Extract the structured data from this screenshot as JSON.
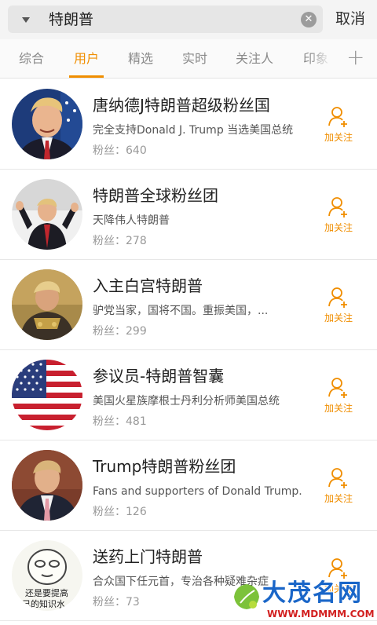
{
  "search": {
    "query": "特朗普",
    "clear_icon": "clear-icon",
    "cancel_label": "取消"
  },
  "tabs": [
    {
      "label": "综合",
      "active": false
    },
    {
      "label": "用户",
      "active": true
    },
    {
      "label": "精选",
      "active": false
    },
    {
      "label": "实时",
      "active": false
    },
    {
      "label": "关注人",
      "active": false
    },
    {
      "label": "印象",
      "active": false
    }
  ],
  "add_tab_icon": "plus-icon",
  "accent_color": "#f08e00",
  "users": [
    {
      "name": "唐纳德J特朗普超级粉丝国",
      "desc": "完全支持Donald J. Trump 当选美国总统",
      "fans_label": "粉丝：",
      "fans": "640",
      "follow_label": "加关注"
    },
    {
      "name": "特朗普全球粉丝团",
      "desc": "天降伟人特朗普",
      "fans_label": "粉丝：",
      "fans": "278",
      "follow_label": "加关注"
    },
    {
      "name": "入主白宫特朗普",
      "desc": "驴党当家，国将不国。重振美国，...",
      "fans_label": "粉丝：",
      "fans": "299",
      "follow_label": "加关注"
    },
    {
      "name": "参议员-特朗普智囊",
      "desc": "美国火星族摩根士丹利分析师美国总统",
      "fans_label": "粉丝：",
      "fans": "481",
      "follow_label": "加关注"
    },
    {
      "name": "Trump特朗普粉丝团",
      "desc": "Fans and supporters of Donald Trump.",
      "fans_label": "粉丝：",
      "fans": "126",
      "follow_label": "加关注"
    },
    {
      "name": "送药上门特朗普",
      "desc": "合众国下任元首，专治各种疑难杂症",
      "fans_label": "粉丝：",
      "fans": "73",
      "follow_label": "加关注"
    }
  ],
  "avatar6_text": [
    "还是要提高",
    "己的知识水"
  ],
  "watermark": {
    "cn": "大茂名网",
    "url": "WWW.MDMMM.COM"
  }
}
